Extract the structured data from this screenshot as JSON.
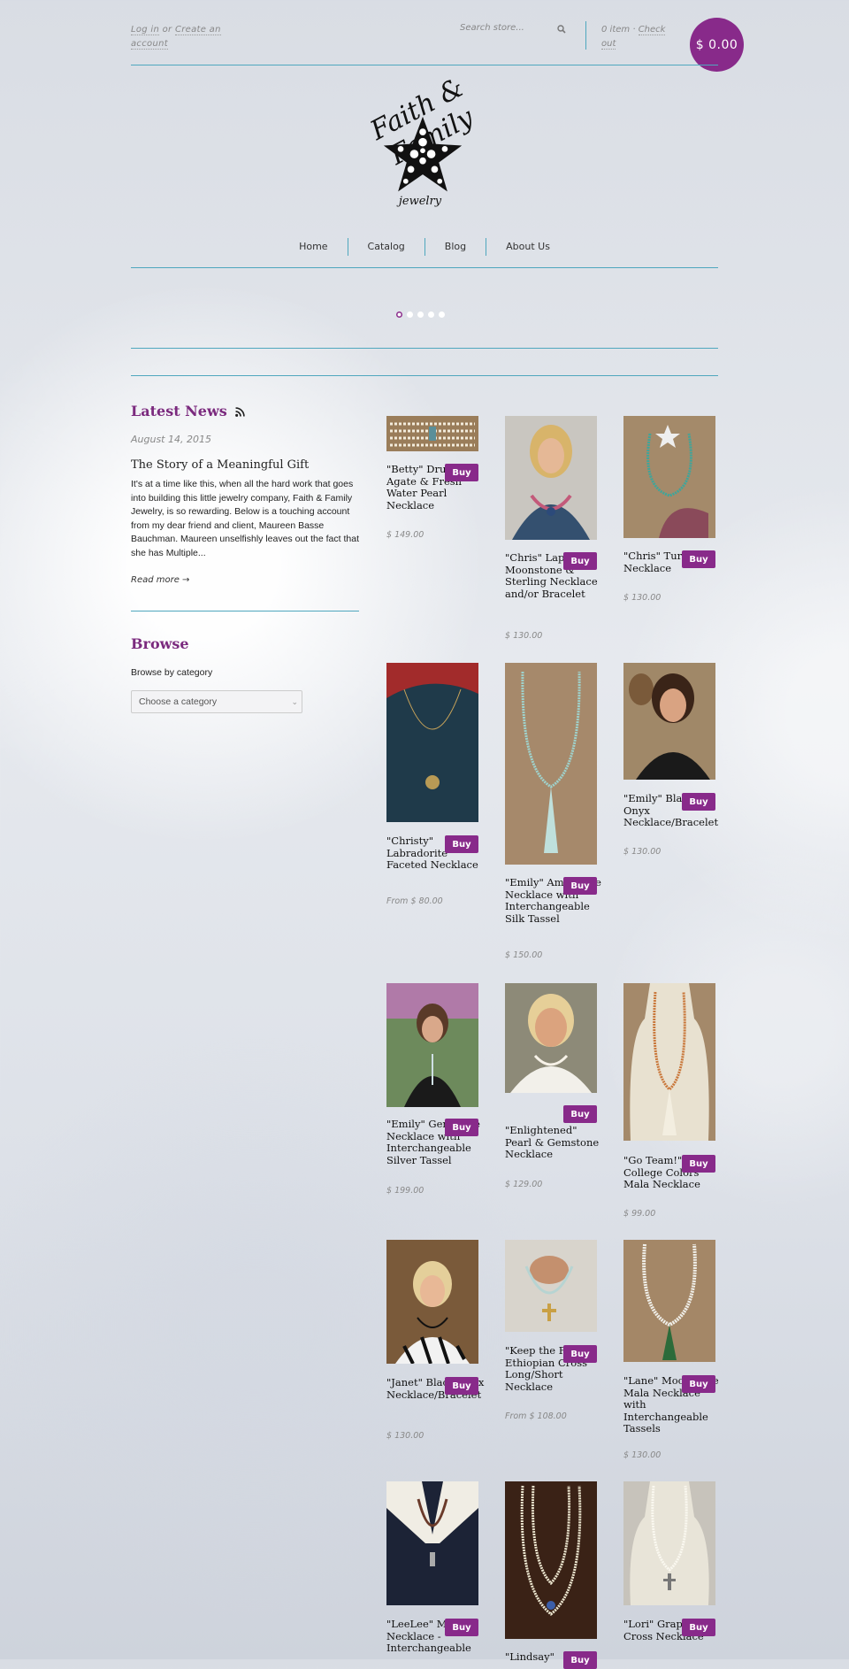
{
  "header": {
    "account_link_login": "Log in",
    "account_or": "or",
    "account_link_create": "Create an account",
    "search_placeholder": "Search store...",
    "cart_items": "0 item",
    "cart_sep": "·",
    "cart_checkout": "Check out",
    "cart_total": "$ 0.00"
  },
  "logo": {
    "line1": "Faith & Family",
    "line2": "jewelry"
  },
  "nav": [
    "Home",
    "Catalog",
    "Blog",
    "About Us"
  ],
  "slideshow": {
    "count": 5,
    "active": 0
  },
  "sidebar": {
    "news_title": "Latest News",
    "post_date": "August 14, 2015",
    "post_title": "The Story of a Meaningful Gift",
    "post_excerpt": "It's at a time like this, when all the hard work that goes into building this little jewelry company, Faith & Family Jewelry, is so rewarding. Below is a touching account from my dear friend and client, Maureen Basse Bauchman. Maureen unselfishly leaves out the fact that she has Multiple...",
    "read_more": "Read more →",
    "browse_title": "Browse",
    "browse_label": "Browse by category",
    "browse_select": "Choose a category"
  },
  "buy_label": "Buy",
  "products": [
    {
      "title": "\"Betty\" Druzy Agate & Fresh Water Pearl Necklace",
      "price": "$ 149.00"
    },
    {
      "title": "\"Chris\" Lapis, Moonstone & Sterling Necklace and/or Bracelet",
      "price": "$ 130.00"
    },
    {
      "title": "\"Chris\" Turquoise Necklace",
      "price": "$ 130.00"
    },
    {
      "title": "\"Christy\" Labradorite Faceted Necklace",
      "price": "From $ 80.00"
    },
    {
      "title": "\"Emily\" Amazonite Necklace with Interchangeable Silk Tassel",
      "price": "$ 150.00"
    },
    {
      "title": "\"Emily\" Black Onyx Necklace/Bracelet",
      "price": "$ 130.00"
    },
    {
      "title": "\"Emily\" Gemstone Necklace with Interchangeable Silver Tassel",
      "price": "$ 199.00"
    },
    {
      "title": "\"Enlightened\" Pearl & Gemstone Necklace",
      "price": "$ 129.00"
    },
    {
      "title": "\"Go Team!\" College Colors Mala Necklace",
      "price": "$ 99.00"
    },
    {
      "title": "\"Janet\" Black Onyx Necklace/Bracelet",
      "price": "$ 130.00"
    },
    {
      "title": "\"Keep the Faith\" Ethiopian Cross Long/Short Necklace",
      "price": "From $ 108.00"
    },
    {
      "title": "\"Lane\" Moonstone Mala Necklace with Interchangeable Tassels",
      "price": "$ 130.00"
    },
    {
      "title": "\"LeeLee\" Mala Necklace - Interchangeable",
      "price": ""
    },
    {
      "title": "\"Lindsay\"",
      "price": ""
    },
    {
      "title": "\"Lori\" Grapevine Cross Necklace",
      "price": ""
    }
  ],
  "colors": {
    "accent": "#882a8a",
    "rule": "#4fa7be"
  }
}
